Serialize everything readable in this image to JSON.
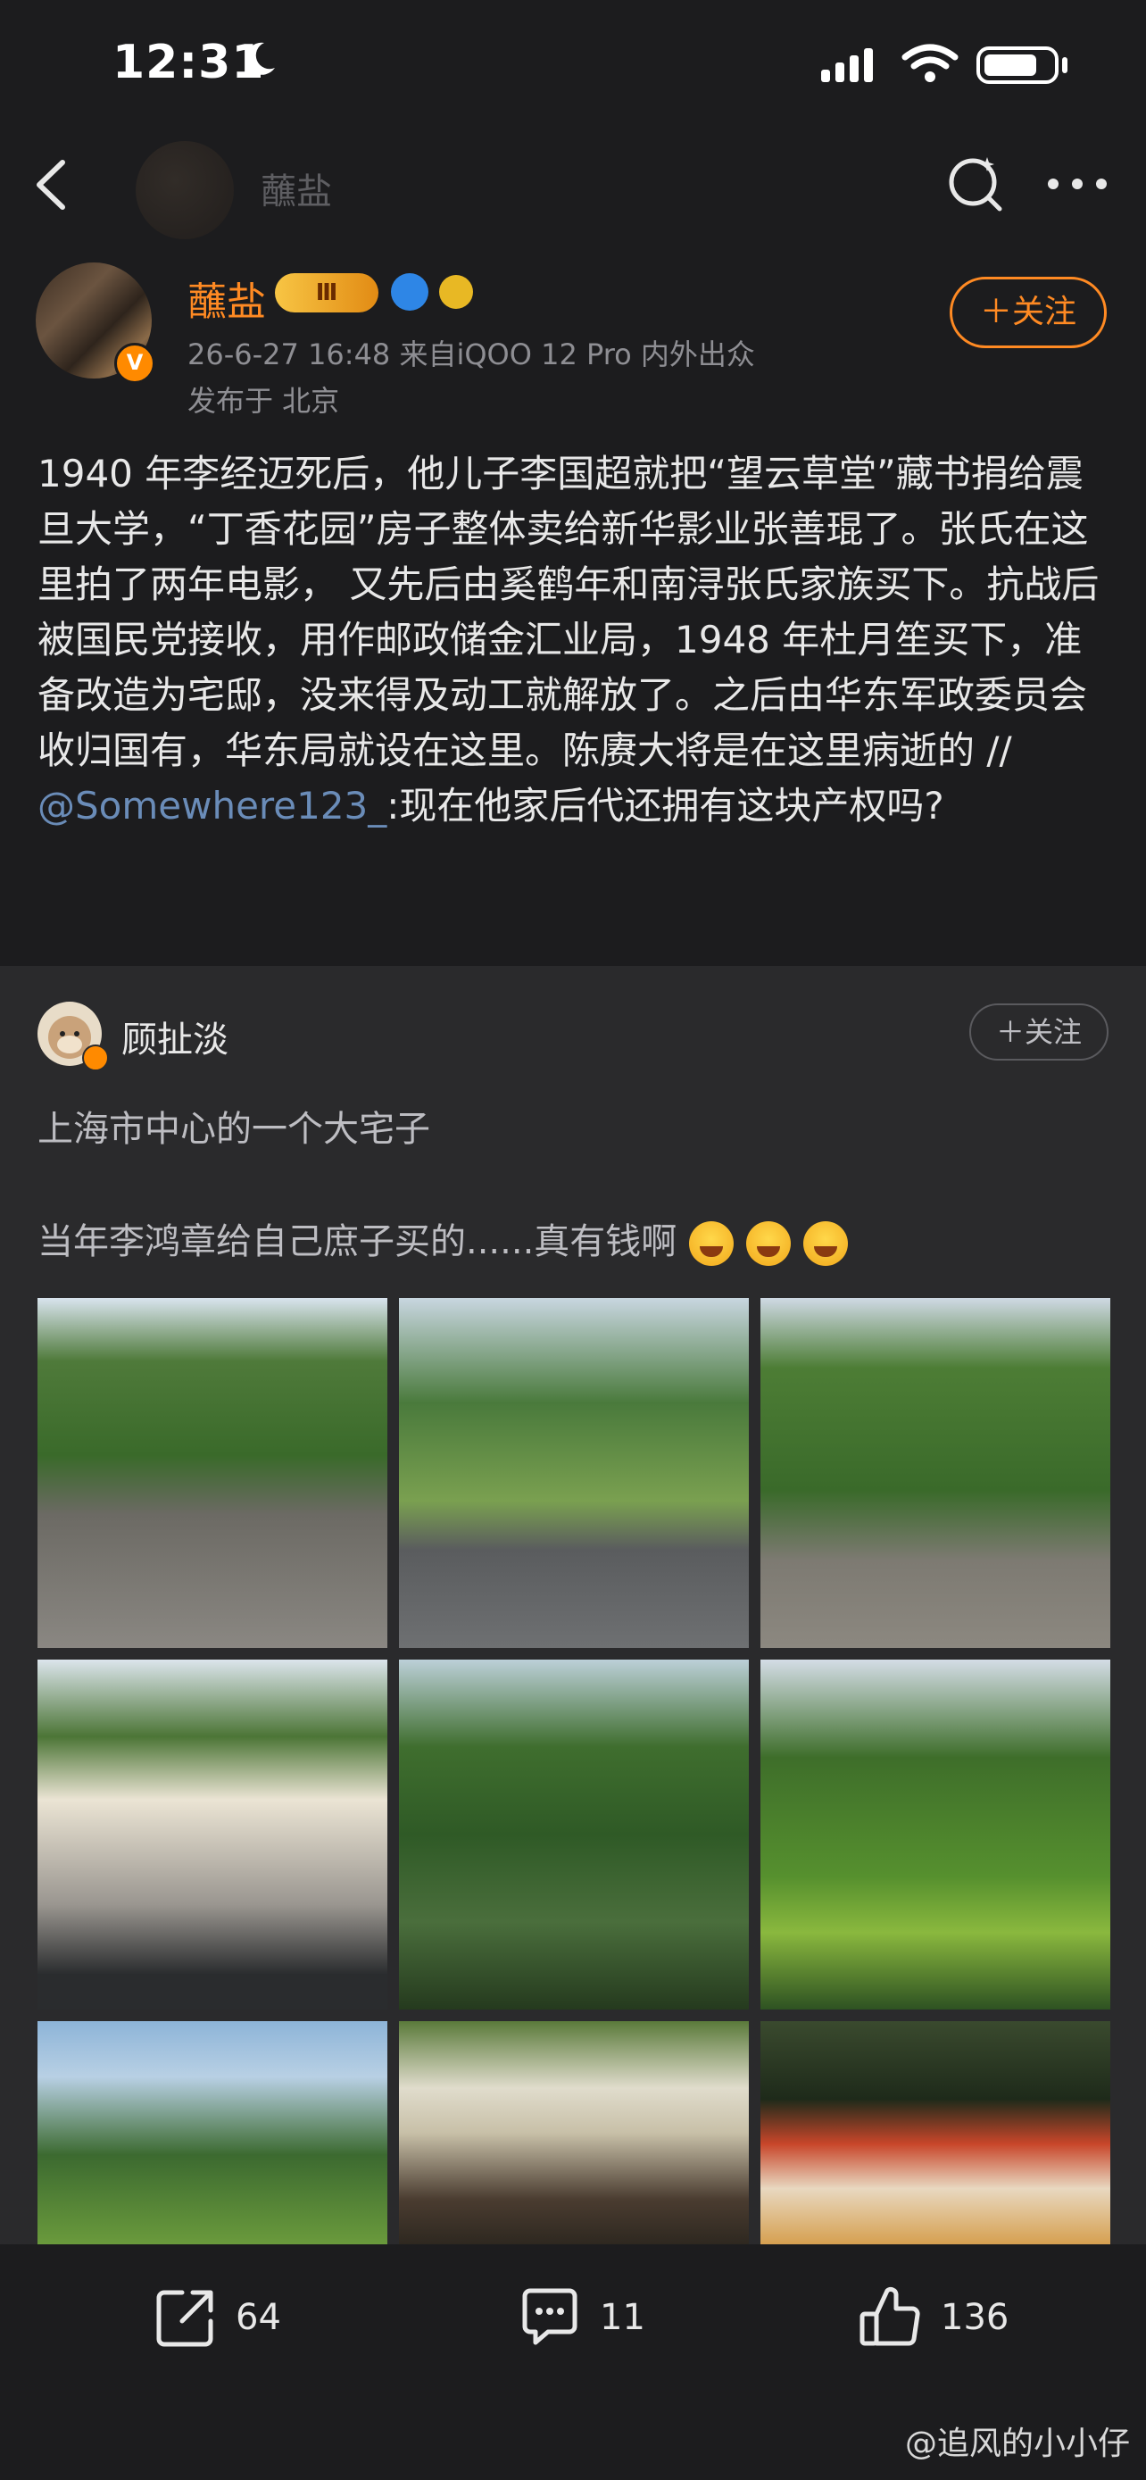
{
  "status": {
    "time": "12:31"
  },
  "nav": {
    "title": "蘸盐"
  },
  "post": {
    "author": "蘸盐",
    "level_badge": "Ⅲ",
    "verified": "V",
    "meta": "26-6-27 16:48  来自iQOO 12 Pro 内外出众",
    "location": "发布于 北京",
    "follow_label": "＋关注",
    "text": "1940 年李经迈死后，他儿子李国超就把“望云草堂”藏书捐给震旦大学，“丁香花园”房子整体卖给新华影业张善琨了。张氏在这里拍了两年电影， 又先后由奚鹤年和南浔张氏家族买下。抗战后被国民党接收，用作邮政储金汇业局，1948 年杜月笙买下，准备改造为宅邸，没来得及动工就解放了。之后由华东军政委员会收归国有，华东局就设在这里。陈赓大将是在这里病逝的 //",
    "mention": "@Somewhere123_",
    "mention_text": ":现在他家后代还拥有这块产权吗?"
  },
  "retweet": {
    "author": "顾扯淡",
    "follow_label": "＋关注",
    "line1": "上海市中心的一个大宅子",
    "line2": "当年李鸿章给自己庶子买的......真有钱啊",
    "photos": [
      "photo-gate",
      "photo-road",
      "photo-garden-path",
      "photo-villa-car",
      "photo-pavilion",
      "photo-lawn",
      "photo-trees-lawn",
      "photo-umbrella-terrace",
      "photo-desserts"
    ]
  },
  "actions": {
    "reposts": "64",
    "comments": "11",
    "likes": "136"
  },
  "watermark": "@追风的小小仔",
  "colors": {
    "accent": "#ff8a23",
    "bg": "#1c1c1e",
    "card": "#2a2a2c",
    "mention": "#6a8cb8"
  }
}
